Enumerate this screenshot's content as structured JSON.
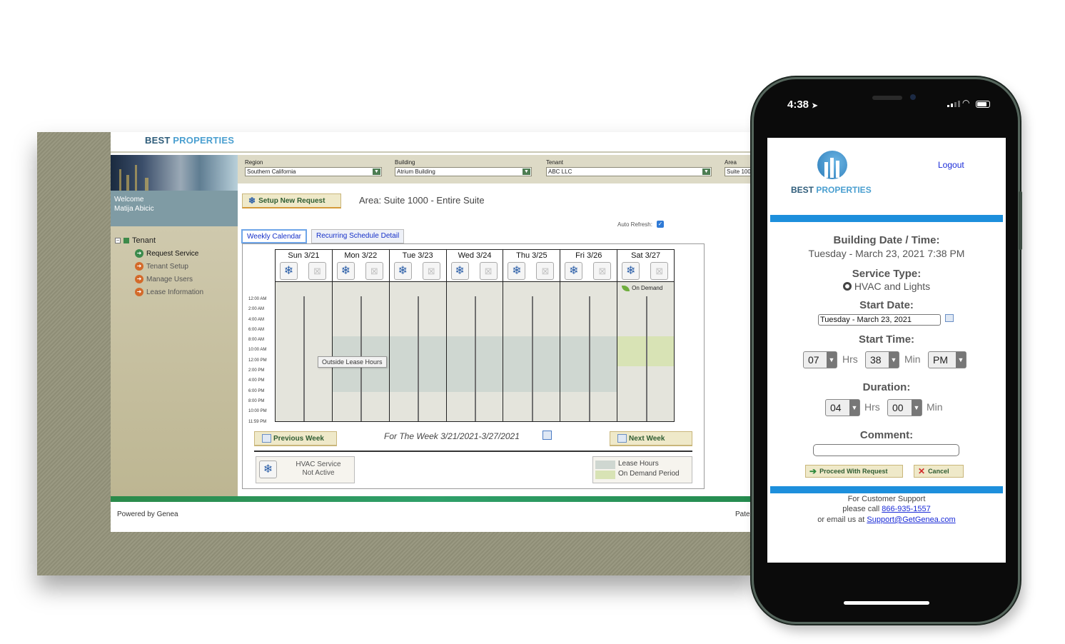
{
  "desktop": {
    "brand": {
      "part1": "BEST ",
      "part2": "PROPERTIES"
    },
    "welcome": {
      "line1": "Welcome",
      "line2": "Matija Abicic"
    },
    "sidebar": {
      "root": "Tenant",
      "items": [
        {
          "label": "Request Service",
          "icon": "arrow-right-icon"
        },
        {
          "label": "Tenant Setup",
          "icon": "arrow-right-icon"
        },
        {
          "label": "Manage Users",
          "icon": "arrow-right-icon"
        },
        {
          "label": "Lease Information",
          "icon": "arrow-right-icon"
        }
      ]
    },
    "filters": {
      "region": {
        "label": "Region",
        "value": "Southern California"
      },
      "building": {
        "label": "Building",
        "value": "Atrium Building"
      },
      "tenant": {
        "label": "Tenant",
        "value": "ABC LLC"
      },
      "area": {
        "label": "Area",
        "value": "Suite 1000 - Entire Suite"
      }
    },
    "setup_button": "Setup New Request",
    "area_title": "Area: Suite 1000 - Entire Suite",
    "auto_refresh": {
      "label": "Auto Refresh:",
      "checked": true
    },
    "tabs": [
      "Weekly Calendar",
      "Recurring Schedule Detail"
    ],
    "calendar": {
      "days": [
        "Sun 3/21",
        "Mon 3/22",
        "Tue 3/23",
        "Wed 3/24",
        "Thu 3/25",
        "Fri 3/26",
        "Sat 3/27"
      ],
      "times": [
        "12:00 AM",
        "2:00 AM",
        "4:00 AM",
        "6:00 AM",
        "8:00 AM",
        "10:00 AM",
        "12:00 PM",
        "2:00 PM",
        "4:00 PM",
        "6:00 PM",
        "8:00 PM",
        "10:00 PM",
        "11:59 PM"
      ],
      "on_demand_label": "On Demand",
      "tooltip": "Outside Lease Hours"
    },
    "prev_week": "Previous Week",
    "next_week": "Next Week",
    "week_label": "For The Week 3/21/2021-3/27/2021",
    "legend": {
      "hvac": {
        "line1": "HVAC Service",
        "line2": "Not Active"
      },
      "lease_hours": "Lease Hours",
      "on_demand_period": "On Demand Period"
    },
    "footer": {
      "powered": "Powered by Genea",
      "right": "Pate"
    }
  },
  "mobile": {
    "status": {
      "time": "4:38"
    },
    "brand": {
      "part1": "BEST ",
      "part2": "PROPERTIES"
    },
    "logout": "Logout",
    "building_datetime_label": "Building Date / Time:",
    "building_datetime_value": "Tuesday - March 23, 2021 7:38 PM",
    "service_type_label": "Service Type:",
    "service_type_value": "HVAC and Lights",
    "start_date_label": "Start Date:",
    "start_date_value": "Tuesday - March 23, 2021",
    "start_time_label": "Start Time:",
    "start_time": {
      "hrs": "07",
      "hrs_unit": "Hrs",
      "min": "38",
      "min_unit": "Min",
      "ampm": "PM"
    },
    "duration_label": "Duration:",
    "duration": {
      "hrs": "04",
      "hrs_unit": "Hrs",
      "min": "00",
      "min_unit": "Min"
    },
    "comment_label": "Comment:",
    "proceed_button": "Proceed With Request",
    "cancel_button": "Cancel",
    "support": {
      "line1": "For Customer Support",
      "line2_prefix": "please call ",
      "phone": "866-935-1557",
      "line3_prefix": "or email us at ",
      "email": "Support@GetGenea.com"
    }
  },
  "colors": {
    "accent_blue": "#1d8fdc",
    "brand_dark": "#2e5c7a",
    "brand_light": "#4a9fd0",
    "green_bar": "#2b8a4a"
  }
}
